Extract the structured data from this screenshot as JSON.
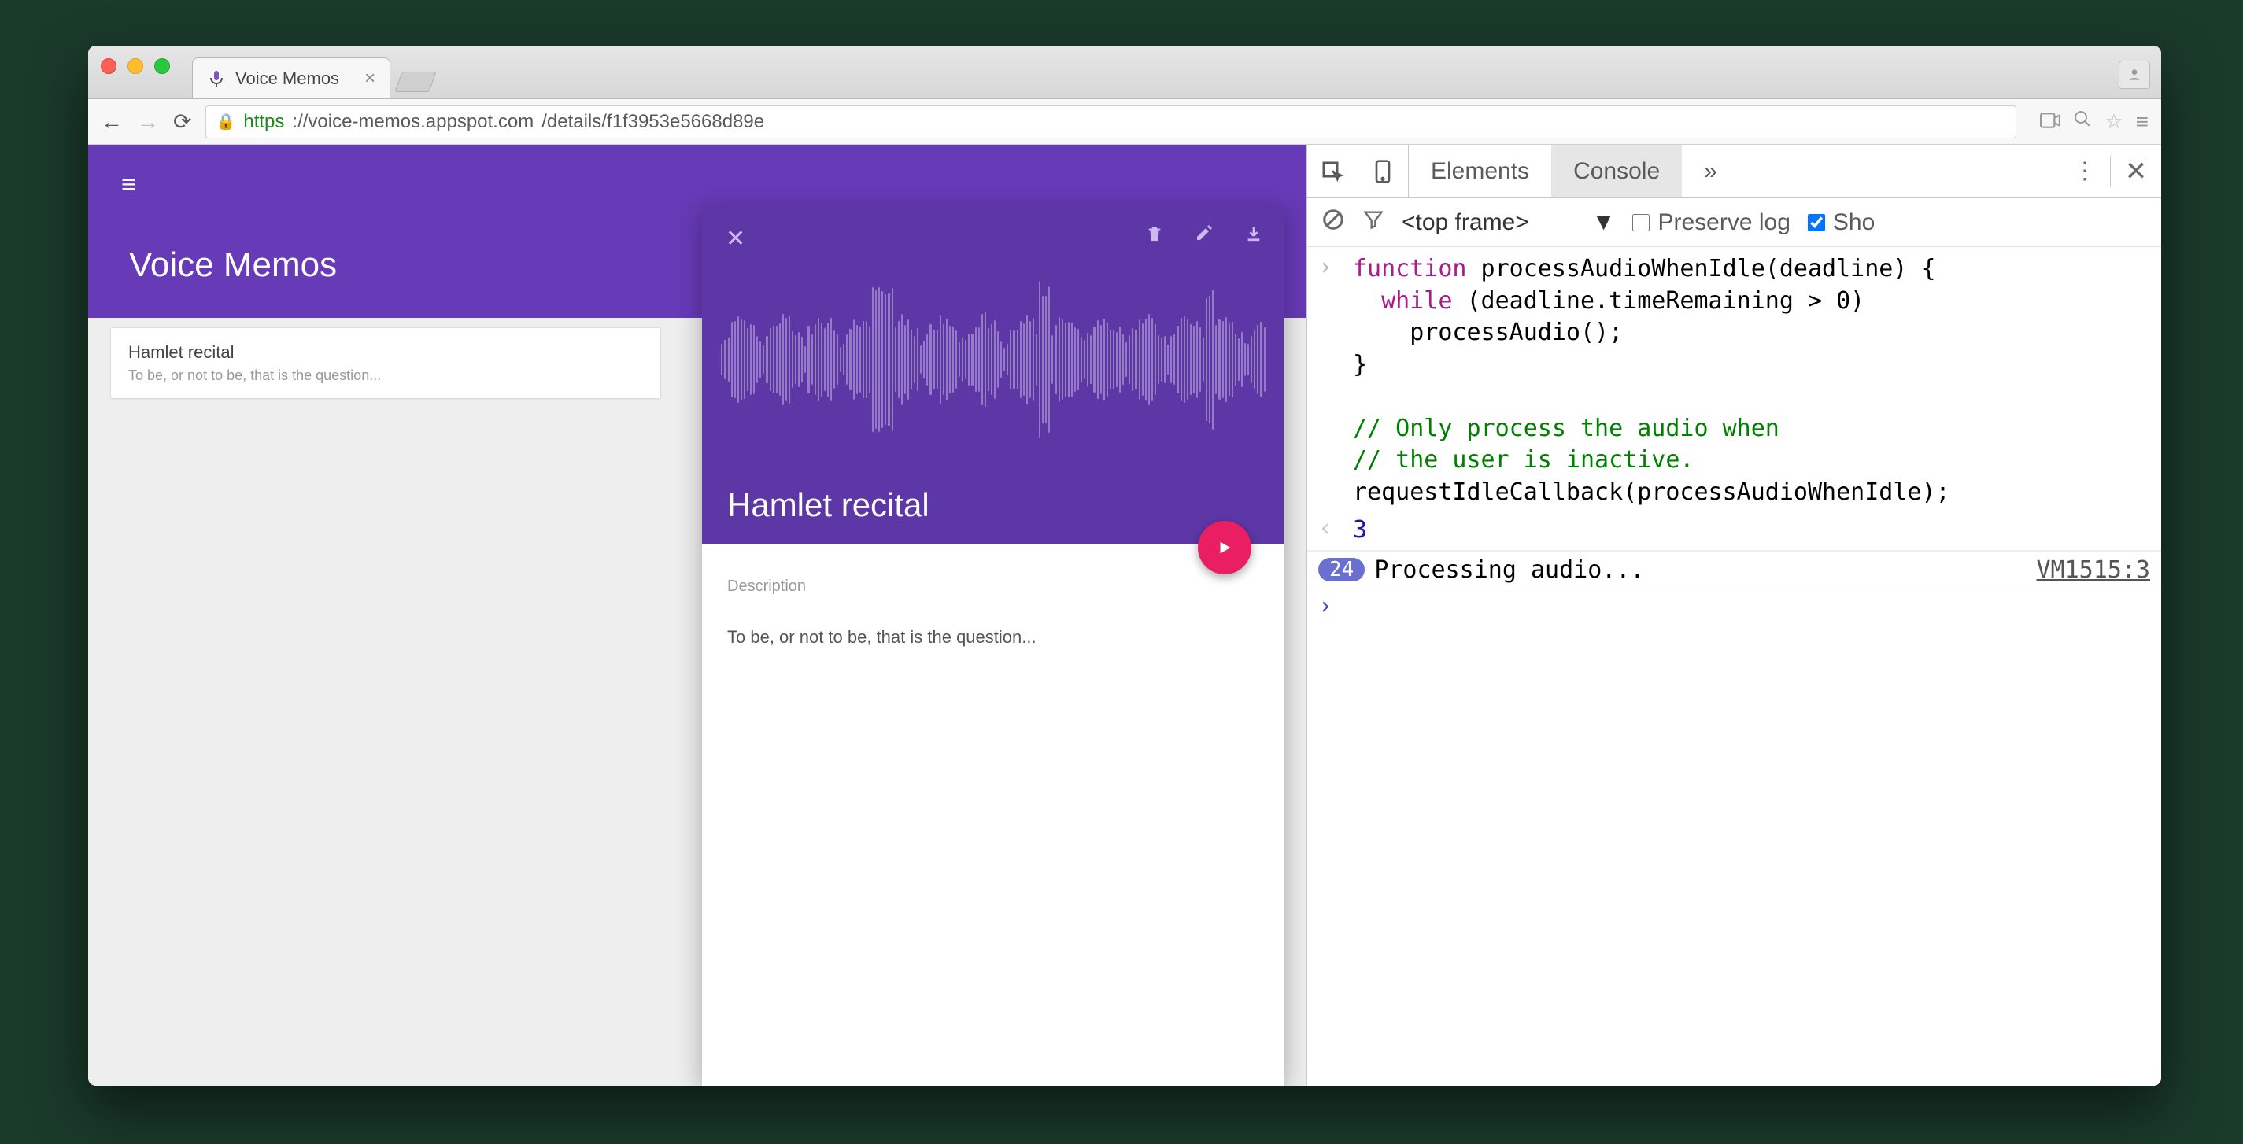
{
  "browser": {
    "tab_title": "Voice Memos",
    "url_protocol": "https",
    "url_host": "://voice-memos.appspot.com",
    "url_path": "/details/f1f3953e5668d89e"
  },
  "app": {
    "title": "Voice Memos",
    "list": {
      "item_title": "Hamlet recital",
      "item_sub": "To be, or not to be, that is the question..."
    },
    "detail": {
      "title": "Hamlet recital",
      "section_label": "Description",
      "description": "To be, or not to be, that is the question..."
    }
  },
  "devtools": {
    "tabs": {
      "elements": "Elements",
      "console": "Console",
      "more": "»"
    },
    "filter": {
      "frame": "<top frame>",
      "preserve": "Preserve log",
      "show": "Sho"
    },
    "code_line1": "function processAudioWhenIdle(deadline) {",
    "code_line2": "  while (deadline.timeRemaining > 0)",
    "code_line3": "    processAudio();",
    "code_line4": "}",
    "code_line5": "",
    "code_line6": "// Only process the audio when",
    "code_line7": "// the user is inactive.",
    "code_line8": "requestIdleCallback(processAudioWhenIdle);",
    "result": "3",
    "log_count": "24",
    "log_msg": "Processing audio...",
    "log_src": "VM1515:3"
  }
}
